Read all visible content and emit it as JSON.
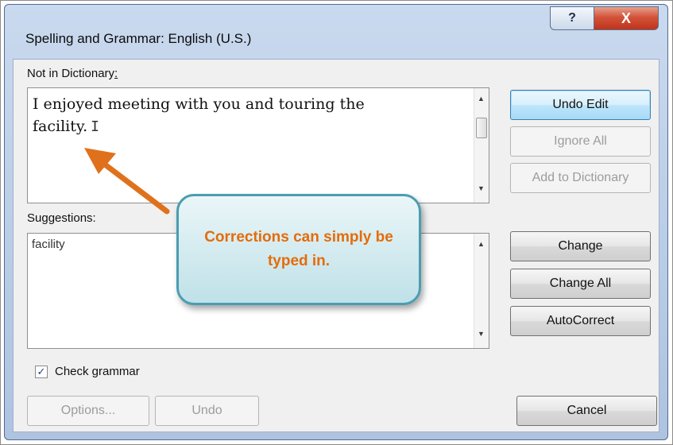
{
  "window": {
    "title": "Spelling and Grammar: English (U.S.)",
    "help_label": "?",
    "close_label": "X"
  },
  "not_in_dictionary": {
    "label": "Not in Dictionary",
    "label_suffix": ":",
    "line1": "I enjoyed meeting with you and touring the",
    "line2": "facility.",
    "cursor_glyph": "I"
  },
  "suggestions": {
    "label": "Suggestions:",
    "items": [
      "facility"
    ]
  },
  "buttons": {
    "undo_edit": "Undo Edit",
    "ignore_all": "Ignore All",
    "add_to_dictionary": "Add to Dictionary",
    "change": "Change",
    "change_all": "Change All",
    "autocorrect": "AutoCorrect",
    "options": "Options...",
    "undo": "Undo",
    "cancel": "Cancel"
  },
  "check_grammar": {
    "label": "Check grammar",
    "checked": true,
    "check_glyph": "✓"
  },
  "callout": {
    "text": "Corrections can simply be typed in.",
    "text_color": "#e46c0a",
    "border_color": "#4b9db0"
  },
  "colors": {
    "arrow": "#e0711c",
    "default_button_border": "#3c7fb1",
    "close_button": "#c0331a"
  },
  "icons": {
    "help": "help-question-icon",
    "close": "close-x-icon",
    "scroll_up": "scroll-up-arrow-icon",
    "scroll_down": "scroll-down-arrow-icon",
    "checkbox": "checkbox-check-icon"
  }
}
